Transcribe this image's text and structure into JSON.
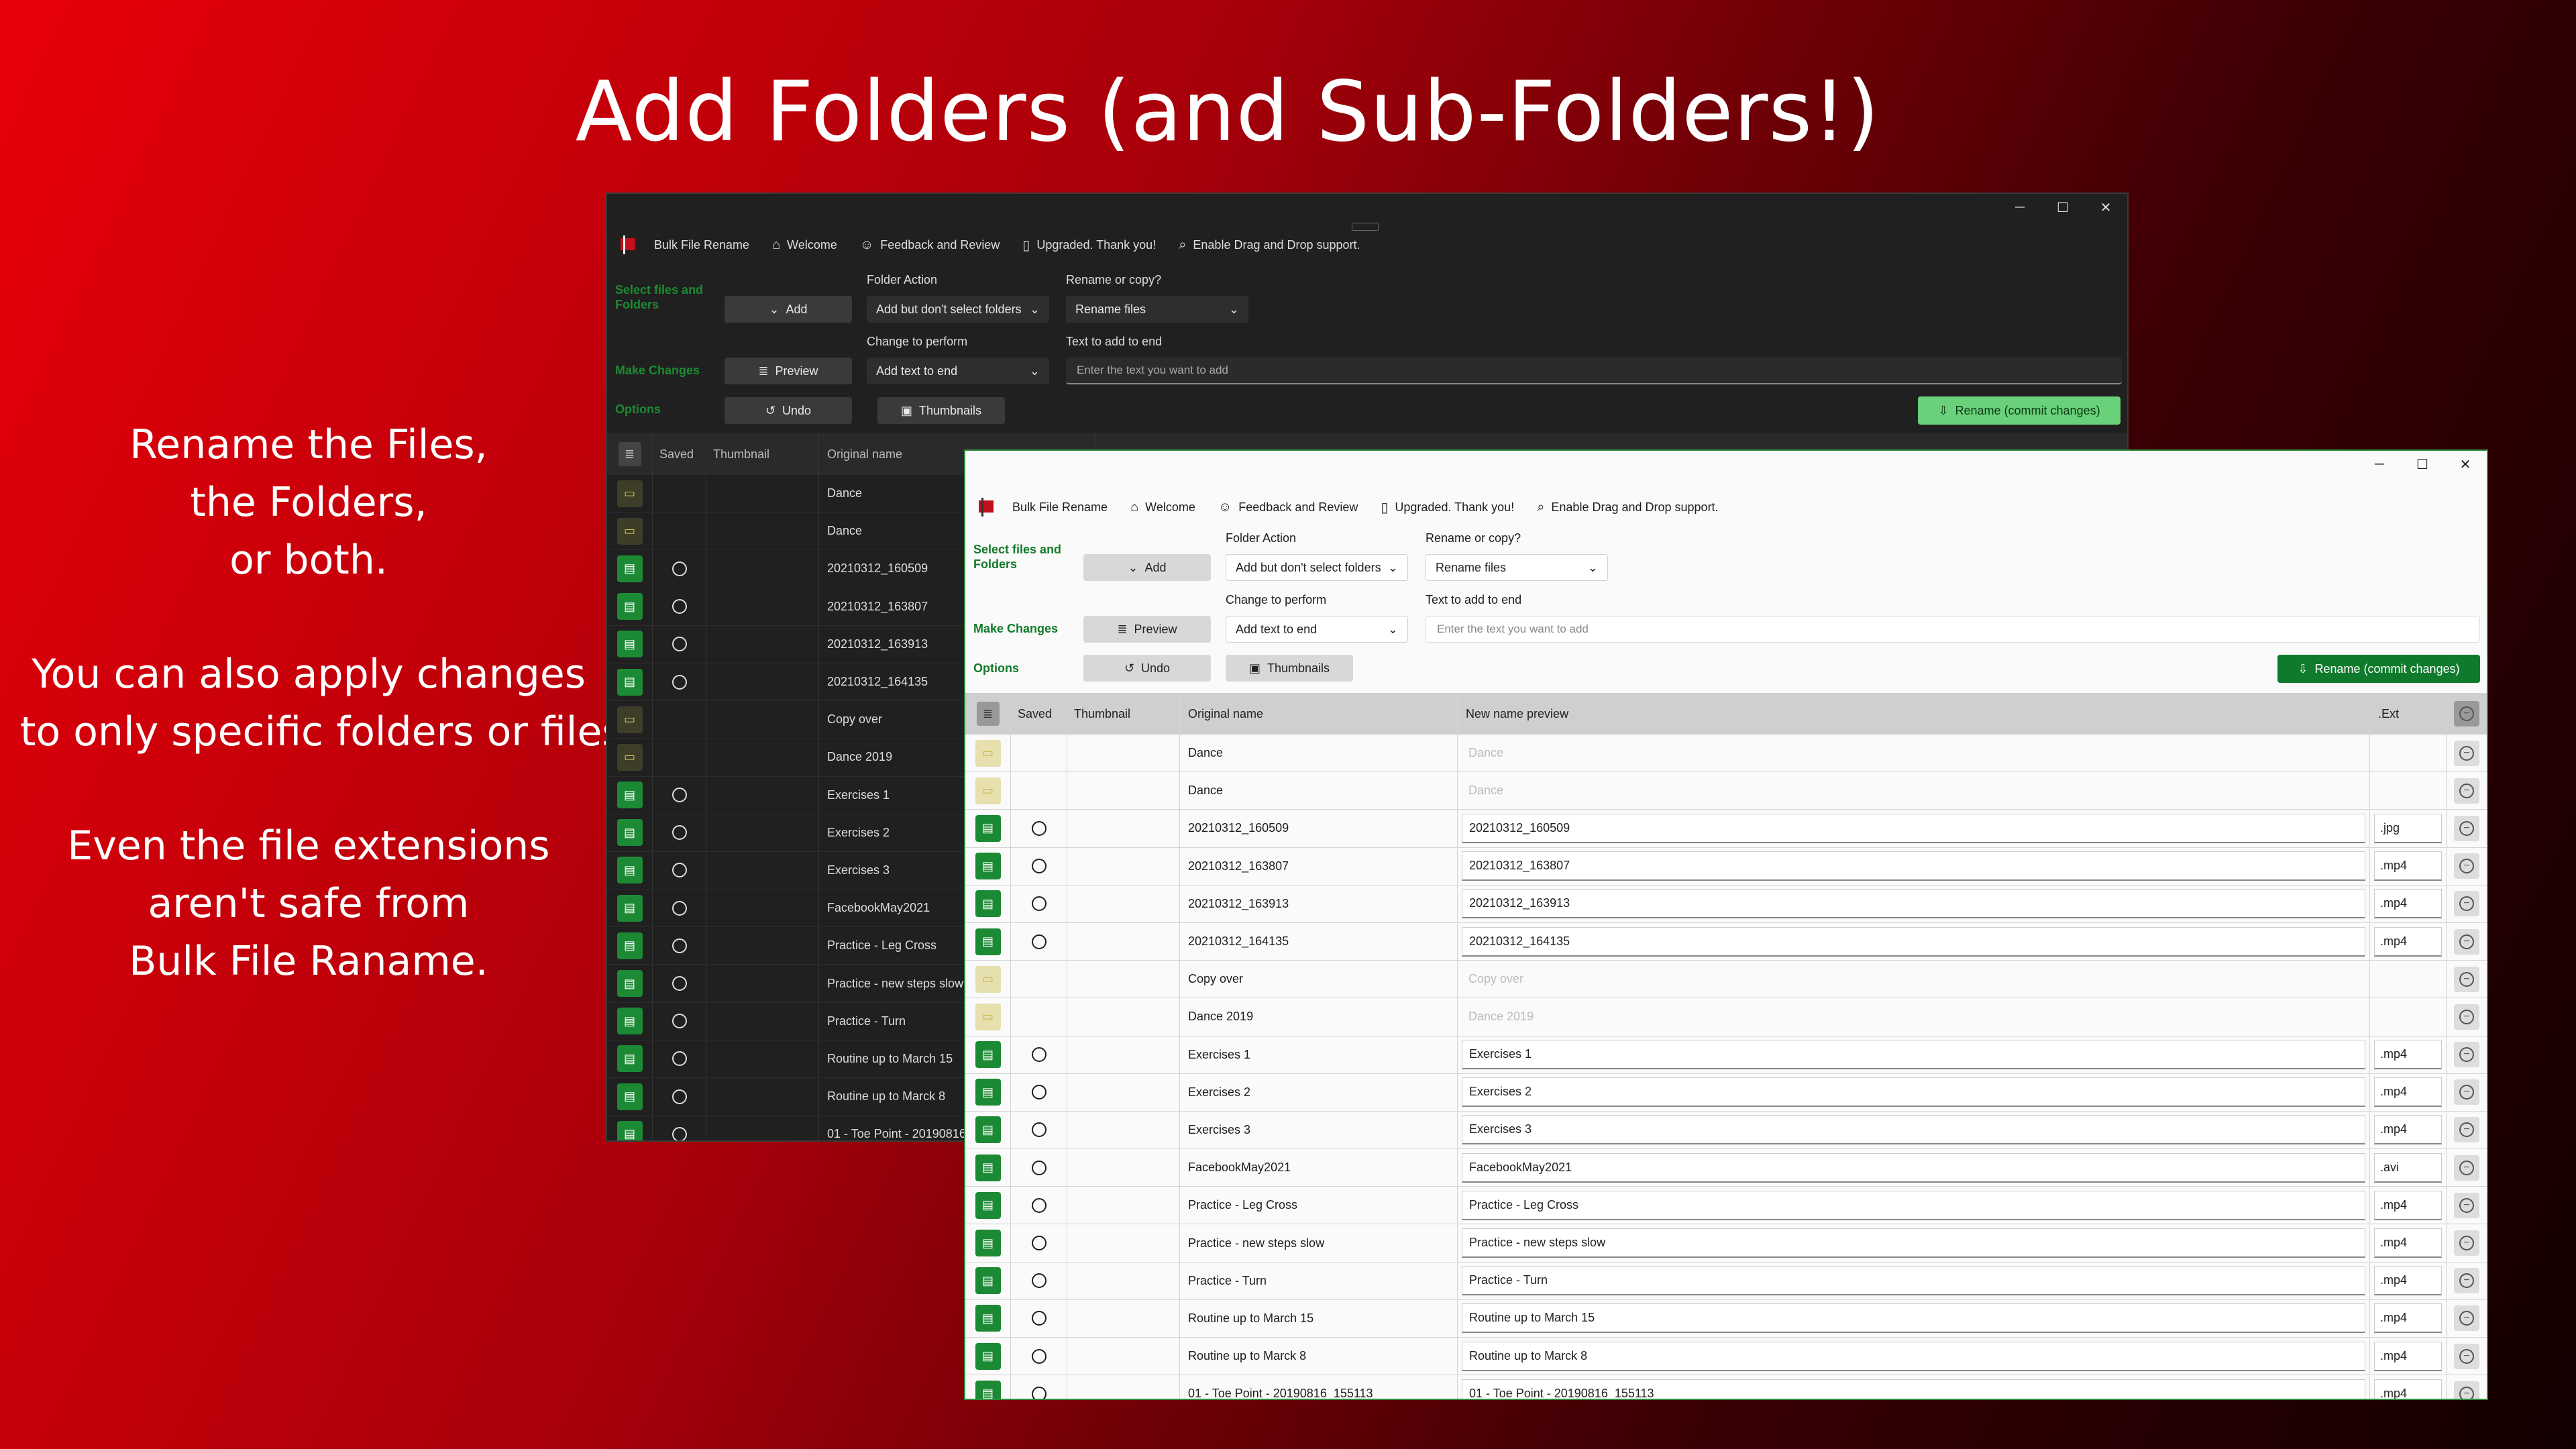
{
  "headline": "Add Folders (and Sub-Folders!)",
  "side_text": {
    "block1": [
      "Rename the Files,",
      "the Folders,",
      "or both."
    ],
    "block2": [
      "You can also apply changes",
      "to only specific folders or files"
    ],
    "block3": [
      "Even the file extensions",
      "aren't safe from",
      "Bulk File Raname."
    ]
  },
  "app": {
    "title": "Bulk File Rename",
    "nav": {
      "welcome": "Welcome",
      "feedback": "Feedback and Review",
      "upgraded": "Upgraded.  Thank you!",
      "drag": "Enable Drag and Drop support."
    },
    "sections": {
      "select": "Select files and Folders",
      "make": "Make Changes",
      "options": "Options"
    },
    "buttons": {
      "add": "Add",
      "preview": "Preview",
      "undo": "Undo",
      "thumbnails": "Thumbnails",
      "commit": "Rename (commit changes)"
    },
    "labels": {
      "folder_action": "Folder Action",
      "rename_or_copy": "Rename or copy?",
      "change": "Change to perform",
      "text_to_add": "Text to add to end"
    },
    "values": {
      "folder_action": "Add but don't select folders",
      "rename_or_copy": "Rename files",
      "change": "Add text to end"
    },
    "placeholder": "Enter the text you want to add",
    "columns": {
      "saved": "Saved",
      "thumbnail": "Thumbnail",
      "original": "Original name",
      "preview": "New name preview",
      "ext": ".Ext"
    }
  },
  "rows": [
    {
      "type": "folder",
      "name": "Dance",
      "ext": ""
    },
    {
      "type": "folder",
      "name": "Dance",
      "ext": ""
    },
    {
      "type": "file",
      "name": "20210312_160509",
      "ext": ".jpg"
    },
    {
      "type": "file",
      "name": "20210312_163807",
      "ext": ".mp4"
    },
    {
      "type": "file",
      "name": "20210312_163913",
      "ext": ".mp4"
    },
    {
      "type": "file",
      "name": "20210312_164135",
      "ext": ".mp4"
    },
    {
      "type": "folder",
      "name": "Copy over",
      "ext": ""
    },
    {
      "type": "folder",
      "name": "Dance 2019",
      "ext": ""
    },
    {
      "type": "file",
      "name": "Exercises 1",
      "ext": ".mp4"
    },
    {
      "type": "file",
      "name": "Exercises 2",
      "ext": ".mp4"
    },
    {
      "type": "file",
      "name": "Exercises 3",
      "ext": ".mp4"
    },
    {
      "type": "file",
      "name": "FacebookMay2021",
      "ext": ".avi"
    },
    {
      "type": "file",
      "name": "Practice - Leg Cross",
      "ext": ".mp4"
    },
    {
      "type": "file",
      "name": "Practice - new steps slow",
      "ext": ".mp4"
    },
    {
      "type": "file",
      "name": "Practice - Turn",
      "ext": ".mp4"
    },
    {
      "type": "file",
      "name": "Routine up to March 15",
      "ext": ".mp4"
    },
    {
      "type": "file",
      "name": "Routine up to Marck 8",
      "ext": ".mp4"
    },
    {
      "type": "file",
      "name": "01 - Toe Point - 20190816_155113",
      "ext": ".mp4"
    }
  ],
  "colors": {
    "accent_green": "#107a2c",
    "folder_yellow": "#d6c449",
    "background_red": "#e8000a"
  }
}
